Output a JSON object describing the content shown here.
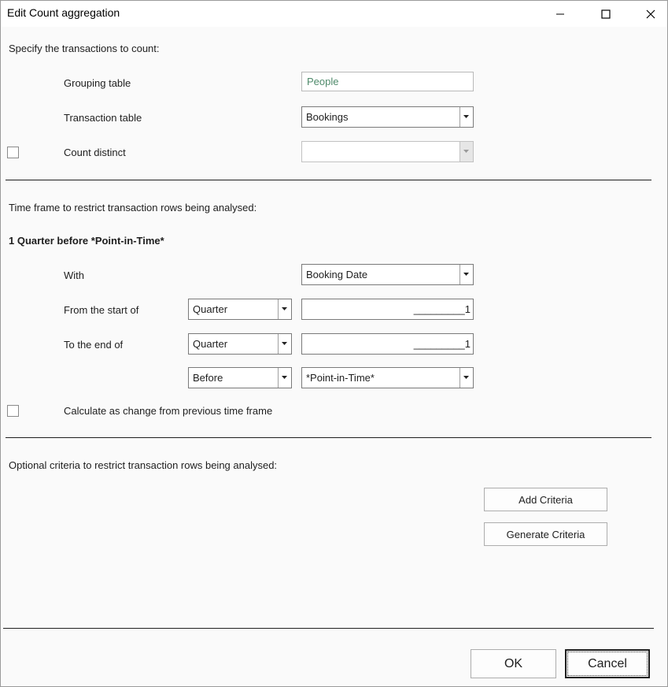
{
  "window": {
    "title": "Edit Count aggregation",
    "controls": [
      "minimize-icon",
      "maximize-icon",
      "close-icon"
    ]
  },
  "section1": {
    "heading": "Specify the transactions to count:",
    "grouping_label": "Grouping table",
    "grouping_value": "People",
    "transaction_label": "Transaction table",
    "transaction_value": "Bookings",
    "distinct_label": "Count distinct",
    "distinct_checked": false,
    "distinct_value": ""
  },
  "section2": {
    "heading": "Time frame to restrict transaction rows being analysed:",
    "summary": "1 Quarter before *Point-in-Time*",
    "with_label": "With",
    "with_value": "Booking Date",
    "from_label": "From the start of",
    "from_period": "Quarter",
    "from_offset": "_________1",
    "to_label": "To the end of",
    "to_period": "Quarter",
    "to_offset": "_________1",
    "relation": "Before",
    "anchor": "*Point-in-Time*",
    "change_label": "Calculate as change from previous time frame",
    "change_checked": false
  },
  "section3": {
    "heading": "Optional criteria to restrict transaction rows being analysed:",
    "add_button": "Add Criteria",
    "generate_button": "Generate Criteria"
  },
  "footer": {
    "ok_button": "OK",
    "cancel_button": "Cancel"
  },
  "colors": {
    "readonly_text": "#4f8a6b",
    "divider": "#1f1f1f",
    "background": "#fafafa"
  }
}
